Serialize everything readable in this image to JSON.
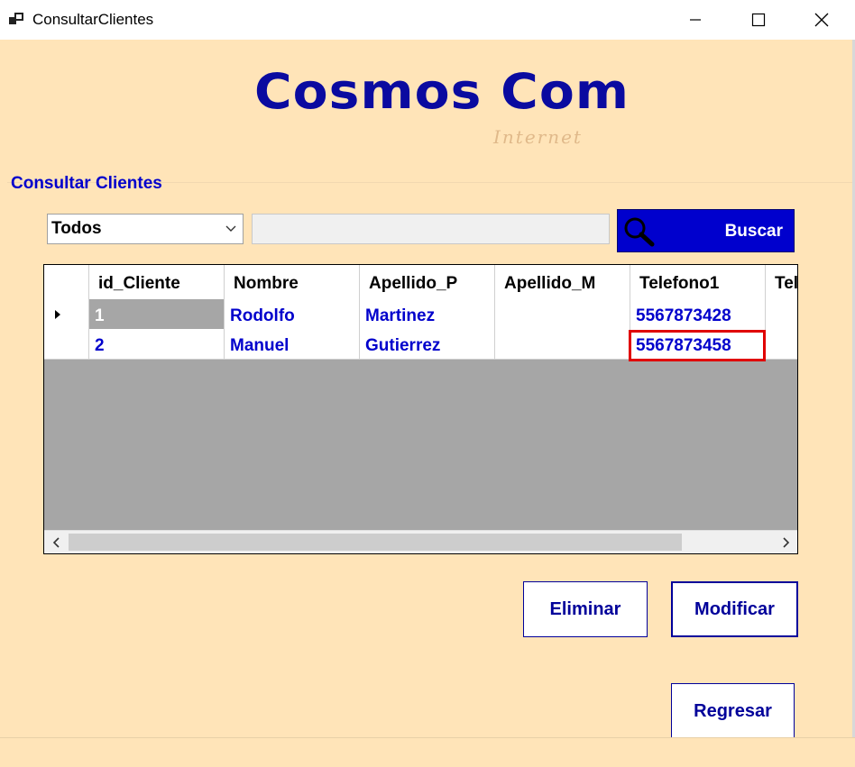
{
  "window": {
    "title": "ConsultarClientes"
  },
  "logo": {
    "main": "Cosmos Com",
    "sub": "Internet"
  },
  "section": {
    "title": "Consultar Clientes"
  },
  "filter": {
    "selected": "Todos",
    "search_value": "",
    "search_button": "Buscar"
  },
  "grid": {
    "columns": [
      "id_Cliente",
      "Nombre",
      "Apellido_P",
      "Apellido_M",
      "Telefono1",
      "Tel"
    ],
    "rows": [
      {
        "id": "1",
        "nombre": "Rodolfo",
        "apellido_p": "Martinez",
        "apellido_m": "",
        "telefono1": "5567873428",
        "tel": ""
      },
      {
        "id": "2",
        "nombre": "Manuel",
        "apellido_p": "Gutierrez",
        "apellido_m": "",
        "telefono1": "5567873458",
        "tel": ""
      }
    ]
  },
  "actions": {
    "eliminar": "Eliminar",
    "modificar": "Modificar",
    "regresar": "Regresar"
  },
  "colors": {
    "background": "#ffe4b8",
    "accent": "#0000cd",
    "text_blue": "#0000cc",
    "highlight": "#e00000"
  }
}
